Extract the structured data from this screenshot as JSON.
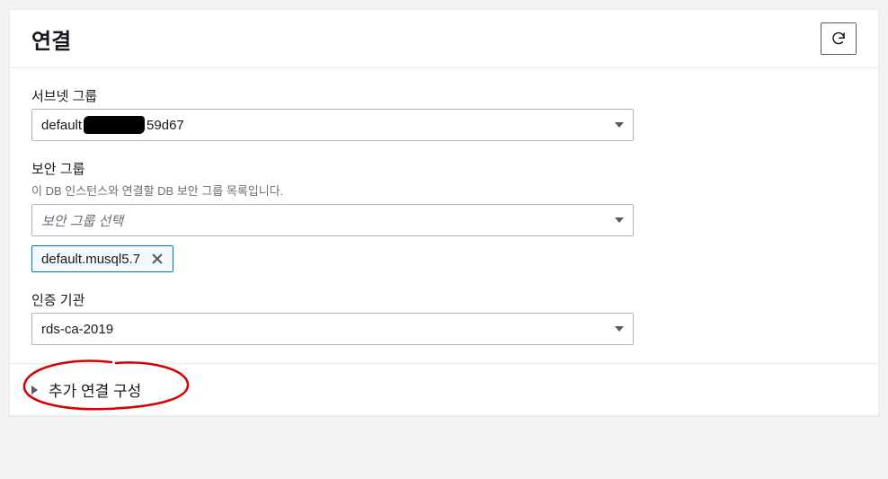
{
  "panel": {
    "title": "연결"
  },
  "subnetGroup": {
    "label": "서브넷 그룹",
    "value_prefix": "default",
    "value_suffix": "59d67"
  },
  "securityGroup": {
    "label": "보안 그룹",
    "description": "이 DB 인스턴스와 연결할 DB 보안 그룹 목록입니다.",
    "placeholder": "보안 그룹 선택",
    "selected_token": "default.musql5.7"
  },
  "certificateAuthority": {
    "label": "인증 기관",
    "value": "rds-ca-2019"
  },
  "expander": {
    "label": "추가 연결 구성"
  }
}
